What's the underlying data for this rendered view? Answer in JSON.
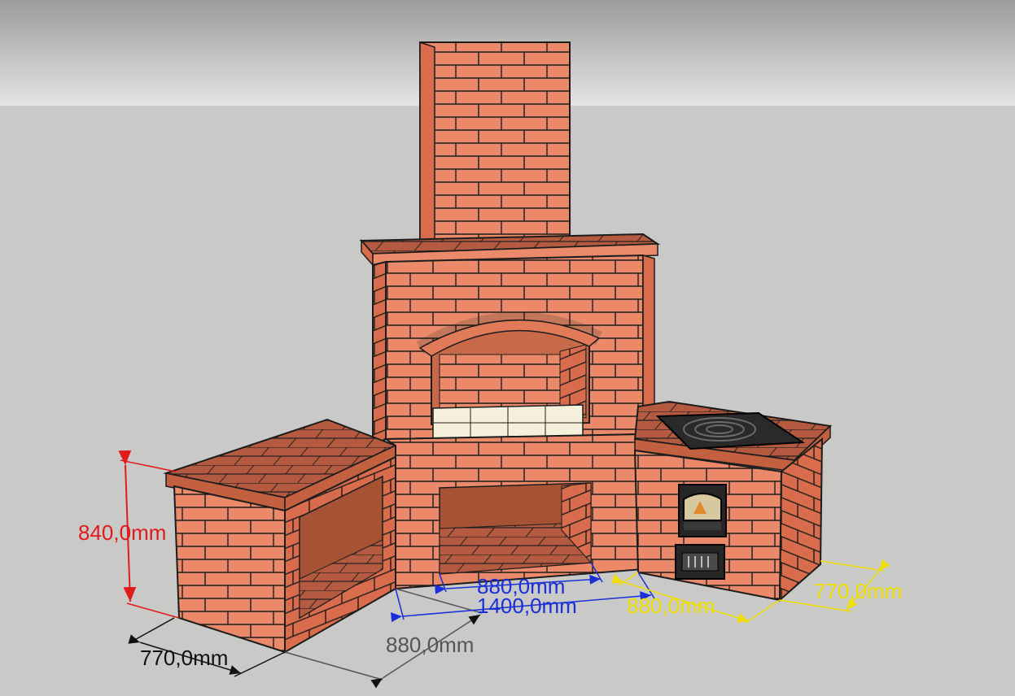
{
  "colors": {
    "sky_top": "#9c9c9a",
    "sky_bottom": "#e2e2e0",
    "ground": "#c9c9c7",
    "brick_front": "#ea8a6a",
    "brick_side": "#d86c4c",
    "brick_top": "#b35a40",
    "mortar": "#1c1c1c",
    "firebox": "#f4f0dc",
    "dim_red": "#e01b1b",
    "dim_blue": "#1a2fd8",
    "dim_yellow": "#f0e000",
    "dim_black": "#111111",
    "dim_gray": "#555555"
  },
  "dimensions": {
    "height": "840,0mm",
    "left_depth": "770,0mm",
    "left_width": "880,0mm",
    "center_inner": "880,0mm",
    "center_total": "1400,0mm",
    "right_width": "880,0mm",
    "right_depth": "770,0mm"
  },
  "stove_parts": [
    "hotplate-icon",
    "firebox-door-icon",
    "ash-door-icon"
  ]
}
